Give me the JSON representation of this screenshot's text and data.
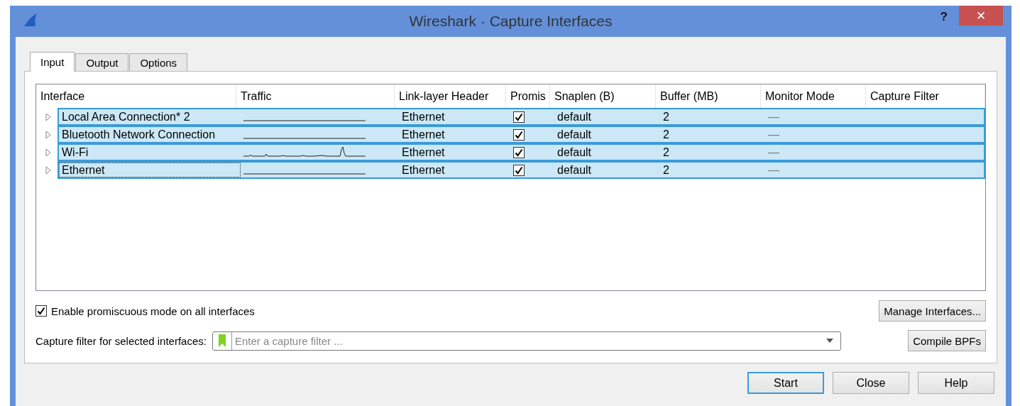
{
  "window": {
    "title": "Wireshark · Capture Interfaces",
    "help": "?",
    "close": "✕"
  },
  "tabs": [
    {
      "label": "Input",
      "selected": true
    },
    {
      "label": "Output",
      "selected": false
    },
    {
      "label": "Options",
      "selected": false
    }
  ],
  "table": {
    "columns": [
      "Interface",
      "Traffic",
      "Link-layer Header",
      "Promis",
      "Snaplen (B)",
      "Buffer (MB)",
      "Monitor Mode",
      "Capture Filter"
    ],
    "rows": [
      {
        "interface": "Local Area Connection* 2",
        "traffic_active": false,
        "link_layer": "Ethernet",
        "promiscuous": true,
        "snaplen": "default",
        "buffer": "2",
        "monitor": "—",
        "selected": true,
        "focused": false,
        "expanded": false
      },
      {
        "interface": "Bluetooth Network Connection",
        "traffic_active": false,
        "link_layer": "Ethernet",
        "promiscuous": true,
        "snaplen": "default",
        "buffer": "2",
        "monitor": "—",
        "selected": true,
        "focused": false,
        "expanded": false
      },
      {
        "interface": "Wi-Fi",
        "traffic_active": true,
        "link_layer": "Ethernet",
        "promiscuous": true,
        "snaplen": "default",
        "buffer": "2",
        "monitor": "—",
        "selected": true,
        "focused": false,
        "expanded": false
      },
      {
        "interface": "Ethernet",
        "traffic_active": false,
        "link_layer": "Ethernet",
        "promiscuous": true,
        "snaplen": "default",
        "buffer": "2",
        "monitor": "—",
        "selected": true,
        "focused": true,
        "expanded": false
      }
    ]
  },
  "promiscuous_all": {
    "label": "Enable promiscuous mode on all interfaces",
    "checked": true
  },
  "manage_button": "Manage Interfaces...",
  "capture_filter": {
    "label": "Capture filter for selected interfaces:",
    "placeholder": "Enter a capture filter ..."
  },
  "compile_button": "Compile BPFs",
  "buttons": [
    {
      "label": "Start",
      "default": true
    },
    {
      "label": "Close",
      "default": false
    },
    {
      "label": "Help",
      "default": false
    }
  ]
}
